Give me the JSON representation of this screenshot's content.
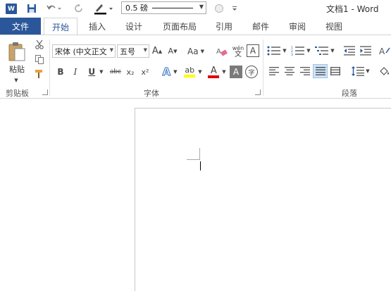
{
  "window": {
    "title": "文档1 - Word"
  },
  "quick_access": {
    "app_icon_letter": "W",
    "line_weight_value": "0.5 磅"
  },
  "tabs": {
    "file": "文件",
    "items": [
      "开始",
      "插入",
      "设计",
      "页面布局",
      "引用",
      "邮件",
      "审阅",
      "视图"
    ],
    "active": "开始"
  },
  "clipboard": {
    "paste_label": "粘贴",
    "group_label": "剪贴板"
  },
  "font": {
    "font_name": "宋体 (中文正文",
    "font_size": "五号",
    "grow": "A",
    "shrink": "A",
    "change_case": "Aa",
    "phonetic_top": "wén",
    "phonetic_bottom": "文",
    "border_char": "A",
    "bold": "B",
    "italic": "I",
    "underline": "U",
    "strike": "abc",
    "subscript": "x₂",
    "superscript": "x²",
    "text_effect": "A",
    "highlight": "ab",
    "font_color": "A",
    "char_shading": "A",
    "enclose_char": "字",
    "group_label": "字体"
  },
  "paragraph": {
    "group_label": "段落"
  },
  "colors": {
    "brand": "#2b579a",
    "highlight": "#ffff00",
    "font_color": "#e00000"
  }
}
